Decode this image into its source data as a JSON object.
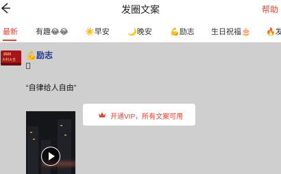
{
  "header": {
    "title": "发圈文案",
    "help_label": "帮助"
  },
  "tabs": [
    {
      "label": "最新",
      "active": true
    },
    {
      "label": "有趣😂😂"
    },
    {
      "label": "☀️早安"
    },
    {
      "label": "🌙晚安"
    },
    {
      "label": "💪励志"
    },
    {
      "label": "生日祝福🎂"
    },
    {
      "label": "🔥发"
    }
  ],
  "post": {
    "author": "💪励志",
    "avatar_text_line1": "2020",
    "avatar_text_line2": "大利大吉",
    "text": "“自律给人自由”"
  },
  "vip_banner": {
    "text": "开通VIP，所有文案可用"
  },
  "colors": {
    "accent": "#e8412f",
    "content_bg": "#cfcfcf",
    "author": "#243a8a"
  },
  "icons": {
    "back": "arrow-left-icon",
    "crown": "crown-icon",
    "play": "play-icon"
  }
}
